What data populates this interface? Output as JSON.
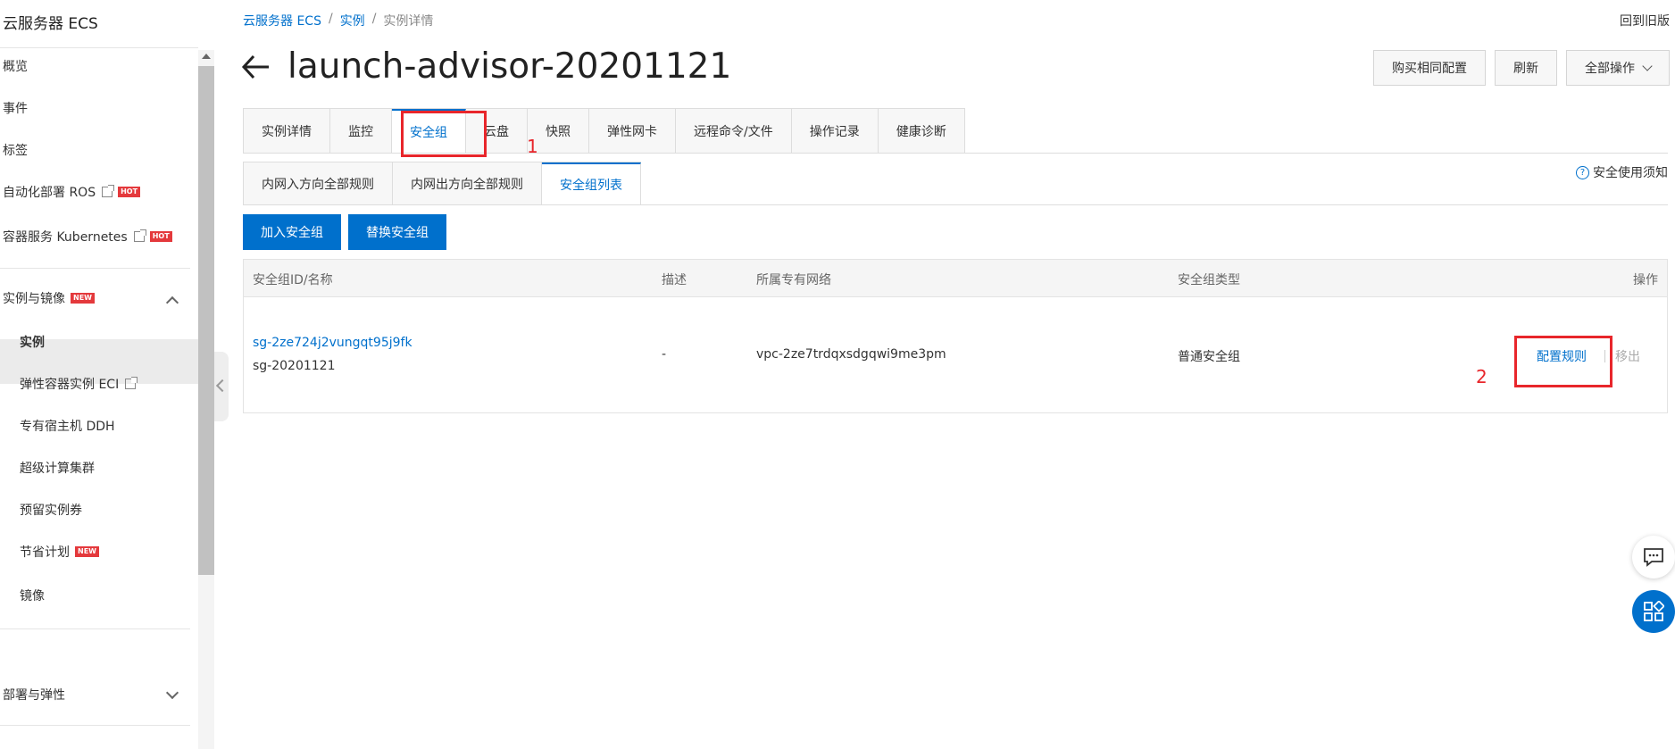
{
  "sidebar": {
    "title": "云服务器 ECS",
    "items": [
      {
        "label": "概览"
      },
      {
        "label": "事件"
      },
      {
        "label": "标签"
      },
      {
        "label": "自动化部署 ROS",
        "badge": "HOT"
      },
      {
        "label": "容器服务 Kubernetes",
        "badge": "HOT"
      }
    ],
    "group_instances": {
      "label": "实例与镜像",
      "badge": "NEW"
    },
    "sub_items": [
      {
        "label": "实例"
      },
      {
        "label": "弹性容器实例 ECI"
      },
      {
        "label": "专有宿主机 DDH"
      },
      {
        "label": "超级计算集群"
      },
      {
        "label": "预留实例券"
      },
      {
        "label": "节省计划",
        "badge": "NEW"
      },
      {
        "label": "镜像"
      }
    ],
    "group_deploy": {
      "label": "部署与弹性"
    }
  },
  "breadcrumb": [
    "云服务器 ECS",
    "/",
    "实例",
    "/",
    "实例详情"
  ],
  "back_old": "回到旧版",
  "title": "launch-advisor-20201121",
  "top_buttons": {
    "buy_same": "购买相同配置",
    "refresh": "刷新",
    "all_ops": "全部操作"
  },
  "tabs": [
    "实例详情",
    "监控",
    "安全组",
    "云盘",
    "快照",
    "弹性网卡",
    "远程命令/文件",
    "操作记录",
    "健康诊断"
  ],
  "subtabs": [
    "内网入方向全部规则",
    "内网出方向全部规则",
    "安全组列表"
  ],
  "notice": "安全使用须知",
  "actions": {
    "join": "加入安全组",
    "replace": "替换安全组"
  },
  "table": {
    "headers": [
      "安全组ID/名称",
      "描述",
      "所属专有网络",
      "安全组类型",
      "操作"
    ],
    "rows": [
      {
        "id": "sg-2ze724j2vungqt95j9fk",
        "name": "sg-20201121",
        "desc": "-",
        "vpc": "vpc-2ze7trdqxsdgqwi9me3pm",
        "type": "普通安全组",
        "op_config": "配置规则",
        "op_remove": "移出"
      }
    ]
  },
  "annotations": [
    "1",
    "2"
  ],
  "colors": {
    "accent": "#0070cc",
    "annotation": "#e8262b",
    "hot": "#e4393c"
  }
}
